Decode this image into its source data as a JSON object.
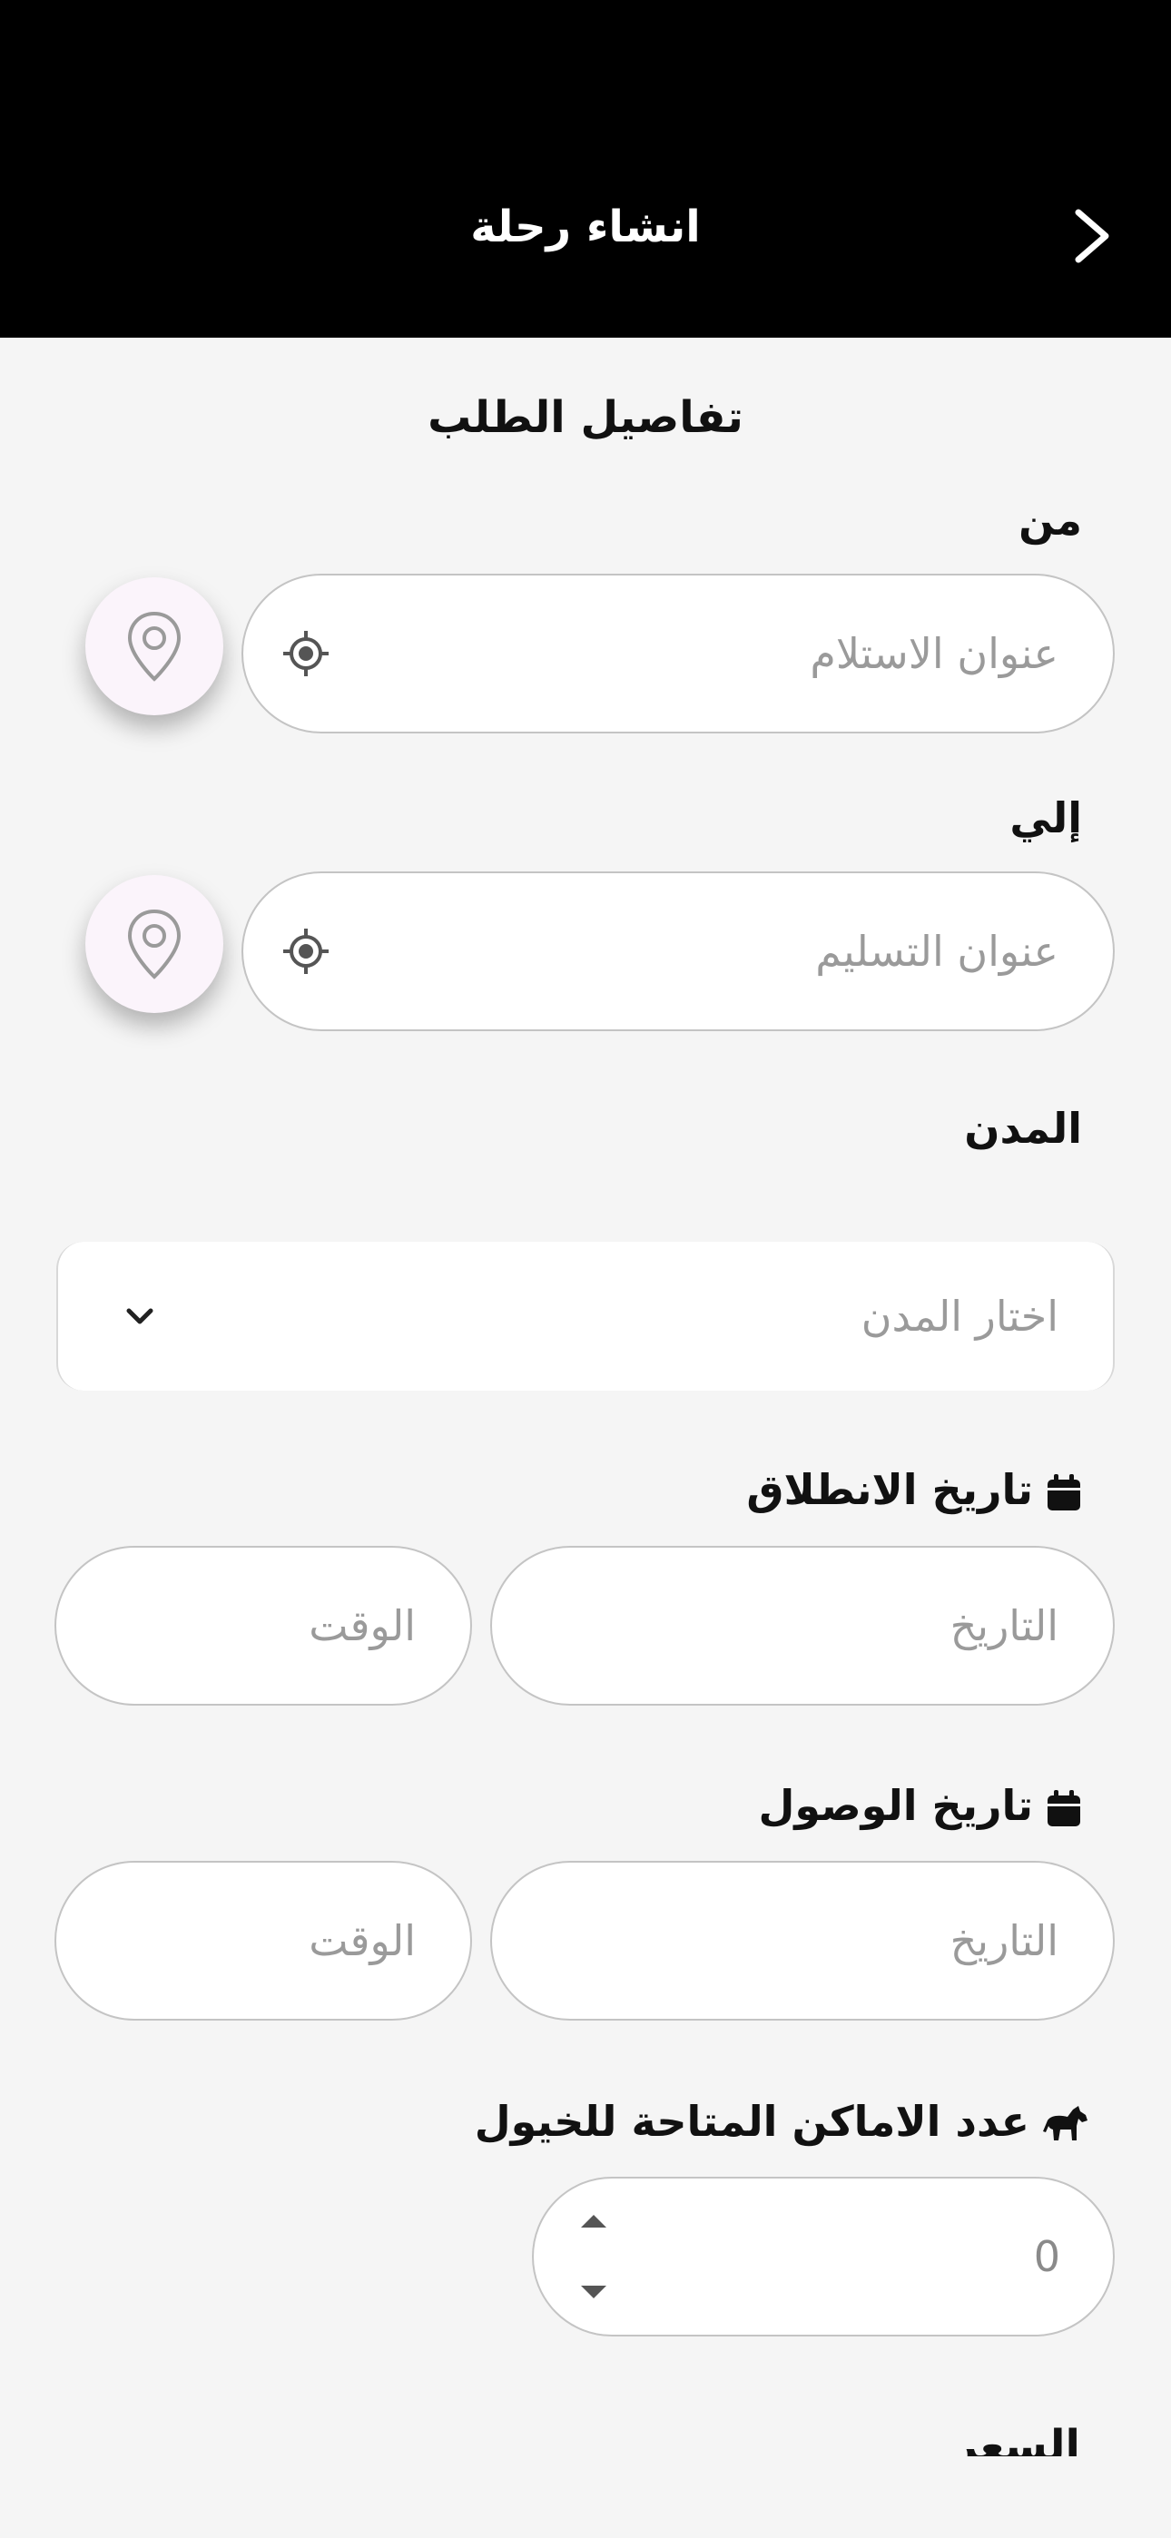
{
  "header": {
    "title": "انشاء رحلة"
  },
  "section": {
    "title": "تفاصيل الطلب"
  },
  "from": {
    "label": "من",
    "placeholder": "عنوان الاستلام"
  },
  "to": {
    "label": "إلي",
    "placeholder": "عنوان التسليم"
  },
  "cities": {
    "label": "المدن",
    "placeholder": "اختار المدن"
  },
  "departure": {
    "label": "تاريخ الانطلاق",
    "date_placeholder": "التاريخ",
    "time_placeholder": "الوقت"
  },
  "arrival": {
    "label": "تاريخ الوصول",
    "date_placeholder": "التاريخ",
    "time_placeholder": "الوقت"
  },
  "horses": {
    "label": "عدد الاماكن المتاحة للخيول",
    "value": "0"
  },
  "price": {
    "label": "السعر"
  },
  "colors": {
    "header_bg": "#000000",
    "page_bg": "#f5f5f5",
    "pin_button_bg": "#fbf4fb",
    "placeholder": "#9a9a9a"
  },
  "icons": {
    "back": "chevron-right-icon",
    "locate": "crosshair-icon",
    "map_pin": "map-pin-icon",
    "dropdown": "chevron-down-icon",
    "calendar": "calendar-icon",
    "horse": "horse-icon"
  }
}
